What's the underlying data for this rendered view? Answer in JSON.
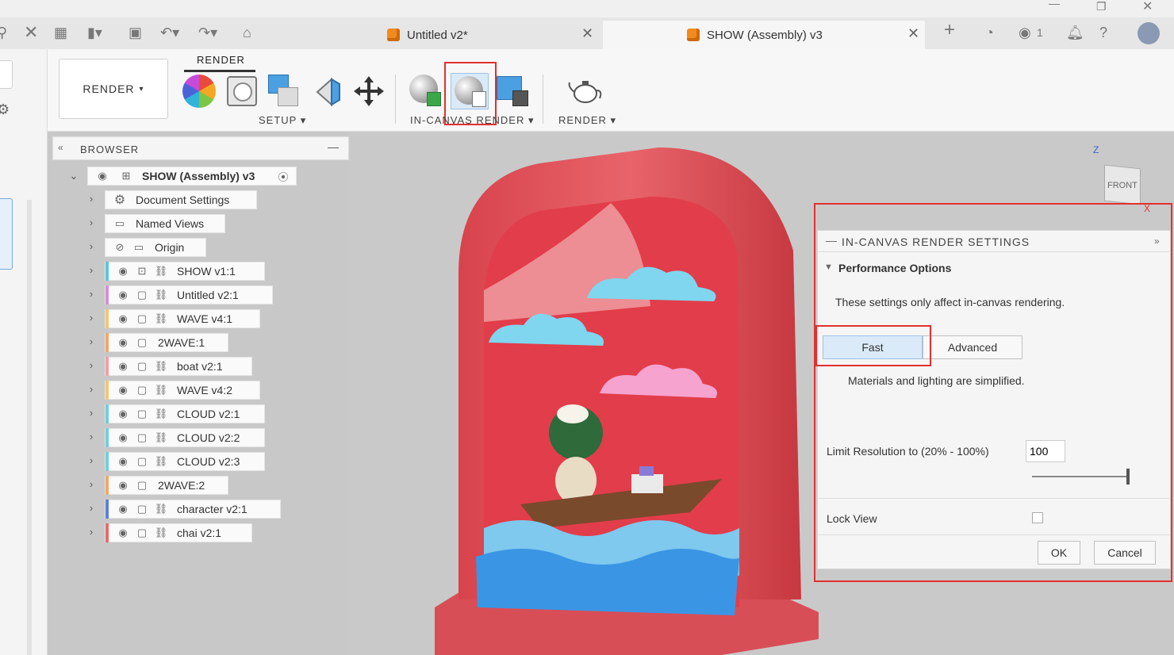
{
  "tabs": [
    {
      "label": "Untitled v2*",
      "active": false
    },
    {
      "label": "SHOW (Assembly) v3",
      "active": true
    }
  ],
  "header": {
    "notification_count": "1"
  },
  "toolbar": {
    "workspace_label": "RENDER",
    "active_tab": "RENDER",
    "groups": {
      "setup": "SETUP",
      "in_canvas": "IN-CANVAS RENDER",
      "render": "RENDER"
    }
  },
  "browser": {
    "title": "BROWSER",
    "root": "SHOW (Assembly) v3",
    "items": [
      {
        "label": "Document Settings",
        "icon": "gear-icon"
      },
      {
        "label": "Named Views",
        "icon": "folder-icon"
      },
      {
        "label": "Origin",
        "icon": "folder-icon",
        "hidden": true
      },
      {
        "label": "SHOW v1:1",
        "color": "#5bc8d4"
      },
      {
        "label": "Untitled v2:1",
        "color": "#d48fd8"
      },
      {
        "label": "WAVE v4:1",
        "color": "#f2c774"
      },
      {
        "label": "2WAVE:1",
        "color": "#f0a866"
      },
      {
        "label": "boat v2:1",
        "color": "#f2a0a6"
      },
      {
        "label": "WAVE v4:2",
        "color": "#f2c774"
      },
      {
        "label": "CLOUD v2:1",
        "color": "#6fd0dc"
      },
      {
        "label": "CLOUD v2:2",
        "color": "#6fd0dc"
      },
      {
        "label": "CLOUD v2:3",
        "color": "#6fd0dc"
      },
      {
        "label": "2WAVE:2",
        "color": "#f0a866"
      },
      {
        "label": "character v2:1",
        "color": "#5d7fd8"
      },
      {
        "label": "chai v2:1",
        "color": "#e96a6a"
      }
    ]
  },
  "viewcube": {
    "face_label": "FRONT",
    "z_axis": "Z",
    "x_axis": "X"
  },
  "render_settings": {
    "title": "IN-CANVAS RENDER SETTINGS",
    "section": "Performance Options",
    "description": "These settings only affect in-canvas rendering.",
    "mode_fast": "Fast",
    "mode_advanced": "Advanced",
    "mode_note": "Materials and lighting are simplified.",
    "resolution_label": "Limit Resolution to (20% - 100%)",
    "resolution_value": "100",
    "lock_view_label": "Lock View",
    "lock_view_checked": false,
    "ok_label": "OK",
    "cancel_label": "Cancel"
  },
  "colors": {
    "highlight": "#e13030",
    "accent_blue": "#3b82c4"
  }
}
